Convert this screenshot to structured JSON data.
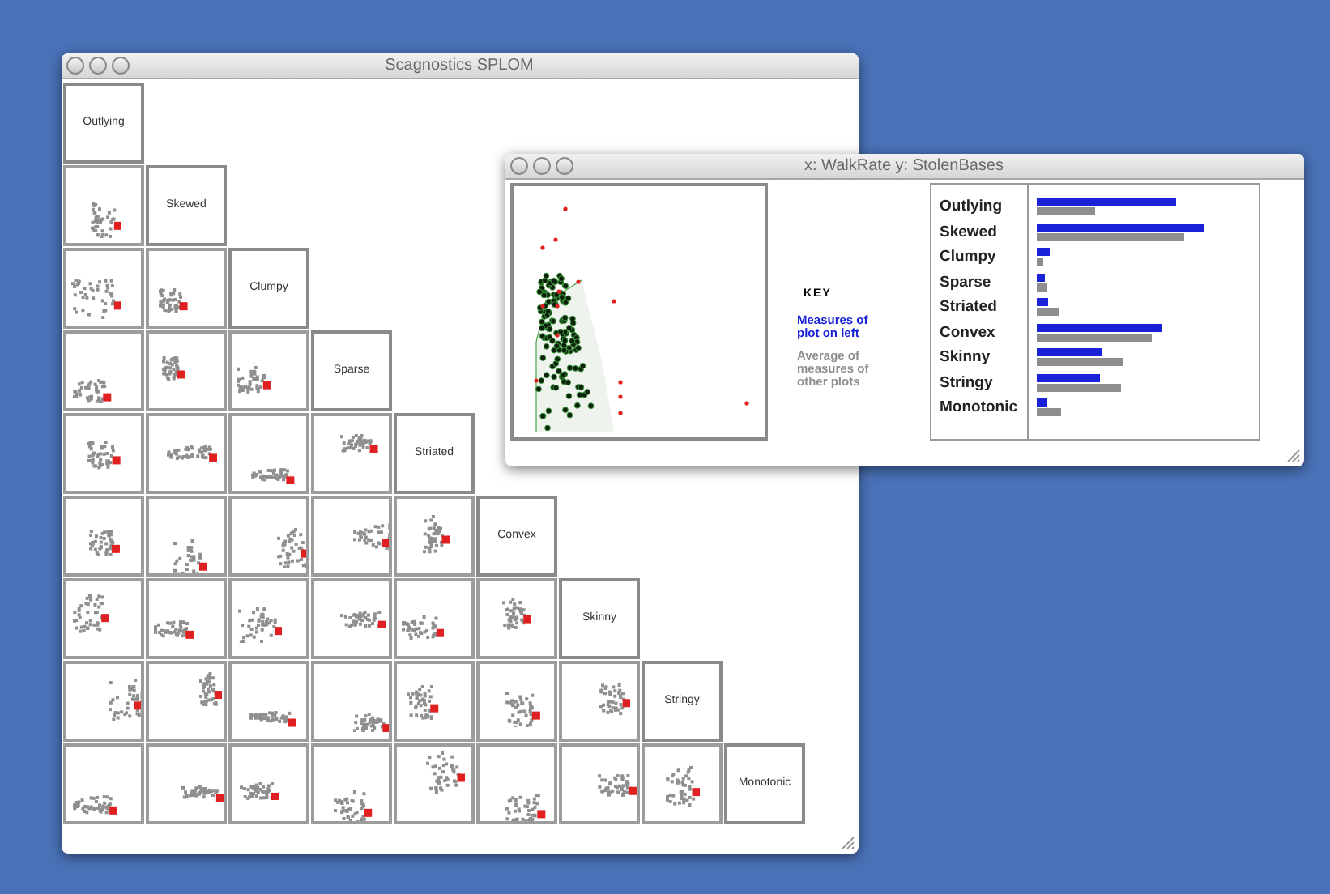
{
  "splom_window": {
    "title": "Scagnostics SPLOM",
    "variables": [
      "Outlying",
      "Skewed",
      "Clumpy",
      "Sparse",
      "Striated",
      "Convex",
      "Skinny",
      "Stringy",
      "Monotonic"
    ]
  },
  "detail_window": {
    "title": "x: WalkRate y: StolenBases",
    "key": {
      "title": "KEY",
      "items": [
        {
          "text": "Measures of plot on left",
          "color": "#1a22d8"
        },
        {
          "text": "Average of measures of other plots",
          "color": "#8e8e8e"
        }
      ]
    },
    "measures": [
      {
        "label": "Outlying"
      },
      {
        "label": "Skewed"
      },
      {
        "label": "Clumpy"
      },
      {
        "label": "Sparse"
      },
      {
        "label": "Striated"
      },
      {
        "label": "Convex"
      },
      {
        "label": "Skinny"
      },
      {
        "label": "Stringy"
      },
      {
        "label": "Monotonic"
      }
    ]
  }
}
